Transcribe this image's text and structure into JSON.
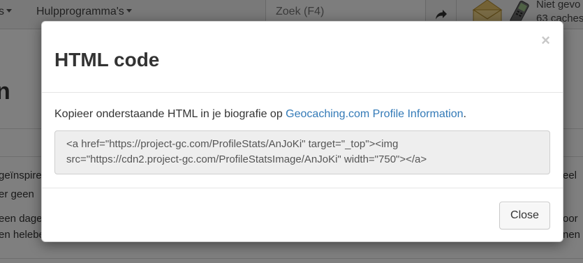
{
  "navbar": {
    "menu_partial": "s",
    "utilities_label": "Hulpprogramma's",
    "search_placeholder": "Zoek (F4)",
    "status_line1": "Niet gevo",
    "status_line2": "63 caches"
  },
  "background": {
    "heading_partial": "n",
    "para1_left_line1": "geïnspire",
    "para1_left_line2": "er geen",
    "para1_right_line1": "eel",
    "para2_left_line1": "een dage",
    "para2_left_line2": "en helebe",
    "para2_right_line1": "oor",
    "para2_right_line2": "nen"
  },
  "modal": {
    "title": "HTML code",
    "close_symbol": "×",
    "intro_text": "Kopieer onderstaande HTML in je biografie op ",
    "intro_link": "Geocaching.com Profile Information",
    "intro_end": ".",
    "code_line1": "<a href=\"https://project-gc.com/ProfileStats/AnJoKi\" target=\"_top\"><img",
    "code_line2": "src=\"https://cdn2.project-gc.com/ProfileStatsImage/AnJoKi\" width=\"750\"></a>",
    "close_button_label": "Close"
  },
  "colors": {
    "link": "#337ab7",
    "overlay": "rgba(0,0,0,0.5)"
  },
  "icons": {
    "share": "share-arrow-icon",
    "messages": "envelope-icon",
    "device": "gps-device-icon",
    "dismiss": "close-icon"
  }
}
